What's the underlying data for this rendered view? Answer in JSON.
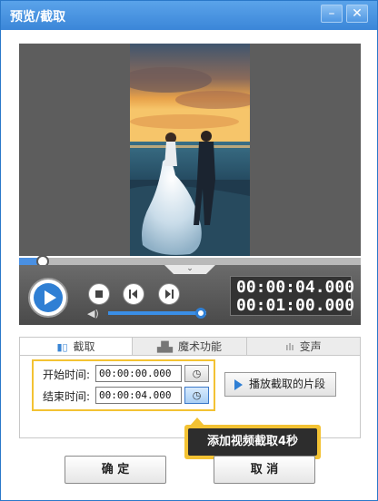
{
  "window": {
    "title": "预览/截取",
    "minimize_glyph": "–",
    "close_glyph": "✕"
  },
  "player": {
    "seek_progress": 0.07,
    "volume_level": 1.0,
    "expand_glyph": "⌄",
    "current_time": "00:00:04.000",
    "total_time": "00:01:00.000",
    "icons": [
      "play-icon",
      "stop-icon",
      "prev-icon",
      "next-icon",
      "volume-icon"
    ]
  },
  "tabs": [
    {
      "label": "截取",
      "icon": "film-icon",
      "glyph": "▮▯"
    },
    {
      "label": "魔术功能",
      "icon": "magic-hat-icon",
      "glyph": "🎩"
    },
    {
      "label": "变声",
      "icon": "waveform-icon",
      "glyph": "ılı"
    }
  ],
  "trim": {
    "start_label": "开始时间:",
    "start_value": "00:00:00.000",
    "end_label": "结束时间:",
    "end_value": "00:00:04.000",
    "set_time_glyph": "◷",
    "play_clip_label": "播放截取的片段"
  },
  "tooltip": {
    "text": "添加视频截取4秒"
  },
  "footer": {
    "ok_label": "确 定",
    "cancel_label": "取 消"
  },
  "colors": {
    "accent": "#2f7fd4",
    "highlight": "#f3c233",
    "titlebar": "#3b86d8"
  }
}
